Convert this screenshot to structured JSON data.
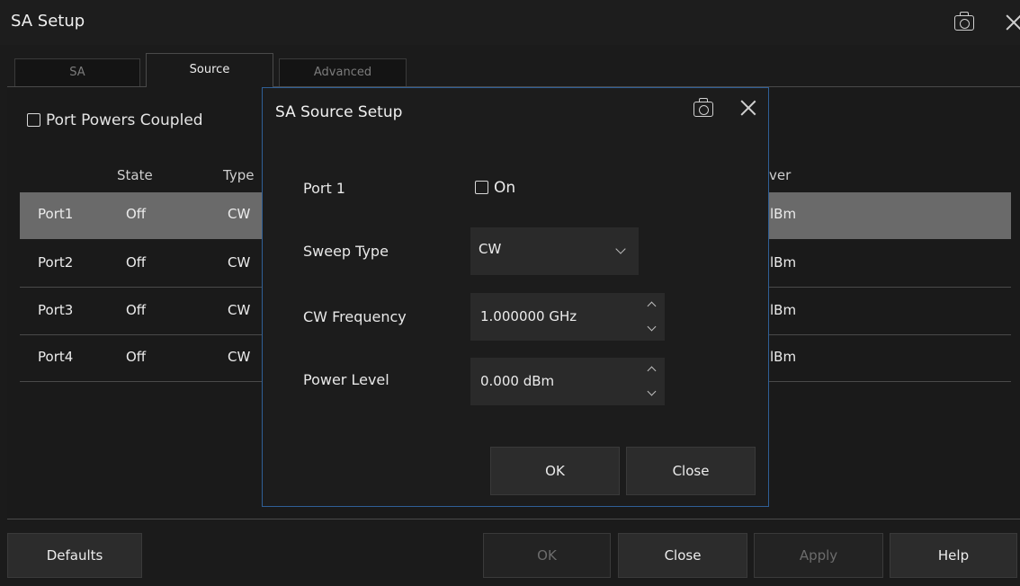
{
  "window": {
    "title": "SA Setup"
  },
  "tabs": [
    {
      "label": "SA",
      "active": false
    },
    {
      "label": "Source",
      "active": true
    },
    {
      "label": "Advanced",
      "active": false
    }
  ],
  "coupled": {
    "label": "Port Powers Coupled",
    "checked": false
  },
  "table": {
    "headers": [
      "State",
      "Type",
      "ver"
    ],
    "rows": [
      {
        "port": "Port1",
        "state": "Off",
        "type": "CW",
        "power": "lBm",
        "selected": true
      },
      {
        "port": "Port2",
        "state": "Off",
        "type": "CW",
        "power": "lBm",
        "selected": false
      },
      {
        "port": "Port3",
        "state": "Off",
        "type": "CW",
        "power": "lBm",
        "selected": false
      },
      {
        "port": "Port4",
        "state": "Off",
        "type": "CW",
        "power": "lBm",
        "selected": false
      }
    ]
  },
  "dialog": {
    "title": "SA Source Setup",
    "port_label": "Port 1",
    "on_label": "On",
    "on_checked": false,
    "sweep_type_label": "Sweep Type",
    "sweep_type_value": "CW",
    "cw_freq_label": "CW Frequency",
    "cw_freq_value": "1.000000 GHz",
    "power_label": "Power Level",
    "power_value": "0.000 dBm",
    "ok": "OK",
    "close": "Close"
  },
  "footer": {
    "defaults": "Defaults",
    "ok": "OK",
    "close": "Close",
    "apply": "Apply",
    "help": "Help"
  },
  "colors": {
    "background": "#1b1b1b",
    "selected_row": "#6a6a6a",
    "dialog_border": "#2f5f96",
    "disabled_text": "#6c6c6c"
  }
}
